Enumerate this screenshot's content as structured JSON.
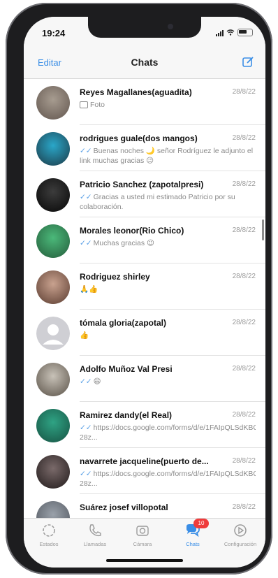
{
  "status": {
    "time": "19:24"
  },
  "nav": {
    "edit": "Editar",
    "title": "Chats"
  },
  "chats": [
    {
      "name": "Reyes Magallanes(aguadita)",
      "date": "28/8/22",
      "preview": "Foto",
      "type": "photo",
      "avatar_colors": [
        "#a79c90",
        "#6c6058"
      ]
    },
    {
      "name": "rodrigues guale(dos mangos)",
      "date": "28/8/22",
      "preview": "Buenas noches 🌙 señor Rodríguez le adjunto el link muchas gracias 😉",
      "type": "tick",
      "avatar_colors": [
        "#2aa7c9",
        "#1e4a5a"
      ]
    },
    {
      "name": "Patricio Sanchez (zapotalpresi)",
      "date": "28/8/22",
      "preview": "Gracias a usted mi estimado Patricio por su colaboración.",
      "type": "tick",
      "avatar_colors": [
        "#3c3c3c",
        "#0f0f0f"
      ]
    },
    {
      "name": "Morales leonor(Rio Chico)",
      "date": "28/8/22",
      "preview": "Muchas gracias 😉",
      "type": "tick",
      "avatar_colors": [
        "#4bb97a",
        "#2a6a44"
      ]
    },
    {
      "name": "Rodriguez shirley",
      "date": "28/8/22",
      "preview": "🙏👍",
      "type": "plain",
      "avatar_colors": [
        "#c9a28f",
        "#6b4b3e"
      ]
    },
    {
      "name": "tómala gloria(zapotal)",
      "date": "28/8/22",
      "preview": "👍",
      "type": "plain",
      "avatar_colors": [
        "#c9c9ce",
        "#c9c9ce"
      ]
    },
    {
      "name": "Adolfo Muñoz Val Presi",
      "date": "28/8/22",
      "preview": "😄",
      "type": "tick",
      "avatar_colors": [
        "#c8c2b8",
        "#6a6258"
      ]
    },
    {
      "name": "Ramirez dandy(el Real)",
      "date": "28/8/22",
      "preview": "https://docs.google.com/forms/d/e/1FAIpQLSdKBQ1vDm2x_VWW074v-28z...",
      "type": "tick",
      "avatar_colors": [
        "#2fa384",
        "#1a5e4c"
      ]
    },
    {
      "name": "navarrete jacqueline(puerto de...",
      "date": "28/8/22",
      "preview": "https://docs.google.com/forms/d/e/1FAIpQLSdKBQ1vDm2x_VWW074v-28z...",
      "type": "tick",
      "avatar_colors": [
        "#7a6a6a",
        "#2e2626"
      ]
    },
    {
      "name": "Suárez josef villopotal",
      "date": "28/8/22",
      "preview": "",
      "type": "plain",
      "avatar_colors": [
        "#9aa1aa",
        "#5a6068"
      ]
    }
  ],
  "tabs": [
    {
      "label": "Estados",
      "icon": "status-icon"
    },
    {
      "label": "Llamadas",
      "icon": "phone-icon"
    },
    {
      "label": "Cámara",
      "icon": "camera-icon"
    },
    {
      "label": "Chats",
      "icon": "chats-icon",
      "badge": "10",
      "active": true
    },
    {
      "label": "Configuración",
      "icon": "settings-icon"
    }
  ],
  "colors": {
    "accent": "#3a8ee6",
    "badge": "#ef3b3b",
    "tick": "#5aa0e6"
  }
}
